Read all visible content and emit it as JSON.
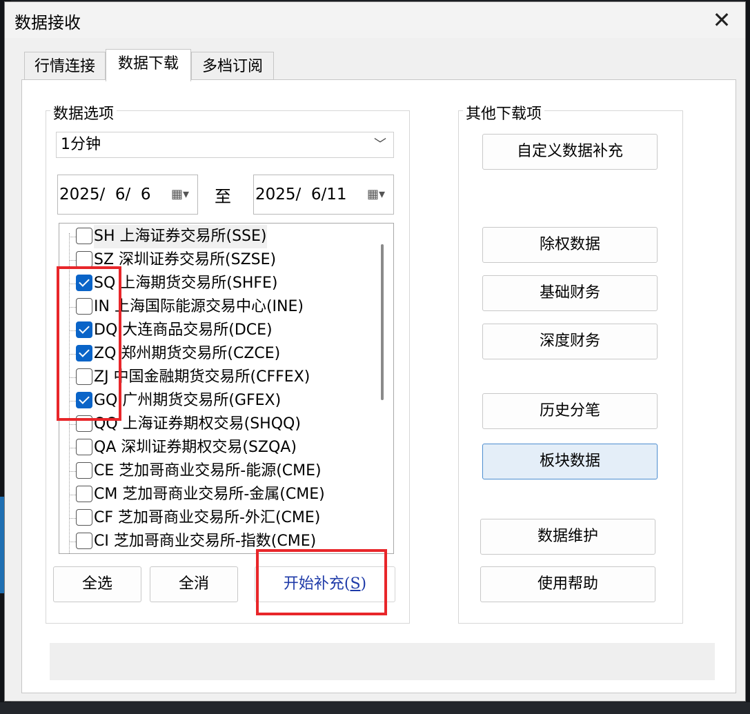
{
  "window": {
    "title": "数据接收",
    "close_glyph": "✕"
  },
  "tabs": [
    {
      "label": "行情连接"
    },
    {
      "label": "数据下载"
    },
    {
      "label": "多档订阅"
    }
  ],
  "data_options": {
    "group_title": "数据选项",
    "period": {
      "value": "1分钟",
      "chevron": "﹀"
    },
    "start_date": "2025/  6/  6",
    "to_label": "至",
    "end_date": "2025/  6/11",
    "calendar_glyph": "▦▾",
    "exchanges": [
      {
        "label": "SH 上海证券交易所(SSE)",
        "checked": false
      },
      {
        "label": "SZ 深圳证券交易所(SZSE)",
        "checked": false
      },
      {
        "label": "SQ 上海期货交易所(SHFE)",
        "checked": true
      },
      {
        "label": "IN 上海国际能源交易中心(INE)",
        "checked": false
      },
      {
        "label": "DQ 大连商品交易所(DCE)",
        "checked": true
      },
      {
        "label": "ZQ 郑州期货交易所(CZCE)",
        "checked": true
      },
      {
        "label": "ZJ 中国金融期货交易所(CFFEX)",
        "checked": false
      },
      {
        "label": "GQ 广州期货交易所(GFEX)",
        "checked": true
      },
      {
        "label": "QQ 上海证券期权交易(SHQQ)",
        "checked": false
      },
      {
        "label": "QA 深圳证券期权交易(SZQA)",
        "checked": false
      },
      {
        "label": "CE 芝加哥商业交易所-能源(CME)",
        "checked": false
      },
      {
        "label": "CM 芝加哥商业交易所-金属(CME)",
        "checked": false
      },
      {
        "label": "CF 芝加哥商业交易所-外汇(CME)",
        "checked": false
      },
      {
        "label": "CI 芝加哥商业交易所-指数(CME)",
        "checked": false
      }
    ],
    "select_all_label": "全选",
    "deselect_all_label": "全消",
    "start_label": "开始补充(",
    "start_hotkey": "S",
    "start_close": ")"
  },
  "other_downloads": {
    "group_title": "其他下载项",
    "custom_label": "自定义数据补充",
    "exright_label": "除权数据",
    "basic_fin_label": "基础财务",
    "deep_fin_label": "深度财务",
    "hist_tick_label": "历史分笔",
    "sector_label": "板块数据",
    "maint_label": "数据维护",
    "help_label": "使用帮助"
  },
  "colors": {
    "accent": "#0a64c8",
    "highlight_box": "#e8262a",
    "hotkey_text": "#1e3aa8"
  }
}
